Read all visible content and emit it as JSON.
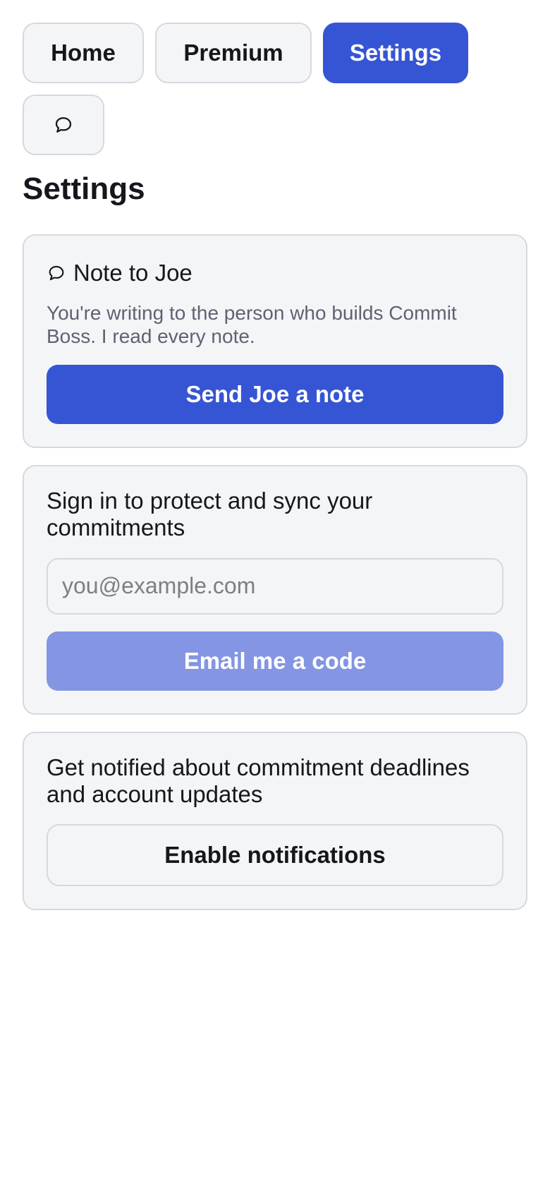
{
  "nav": {
    "home_label": "Home",
    "premium_label": "Premium",
    "settings_label": "Settings",
    "chat_icon": "speech-bubble-icon",
    "active": "Settings"
  },
  "page": {
    "title": "Settings"
  },
  "note_card": {
    "icon": "speech-bubble-icon",
    "heading": "Note to Joe",
    "description": "You're writing to the person who builds Commit Boss. I read every note.",
    "button_label": "Send Joe a note"
  },
  "signin_card": {
    "heading": "Sign in to protect and sync your commitments",
    "email_value": "",
    "email_placeholder": "you@example.com",
    "button_label": "Email me a code",
    "button_state": "disabled"
  },
  "notify_card": {
    "heading": "Get notified about commitment deadlines and account updates",
    "button_label": "Enable notifications"
  },
  "colors": {
    "accent": "#3655d4",
    "accent_disabled": "#8395e3",
    "card_bg": "#f4f5f7",
    "border": "#d5d9df",
    "muted_text": "#5d6371"
  }
}
